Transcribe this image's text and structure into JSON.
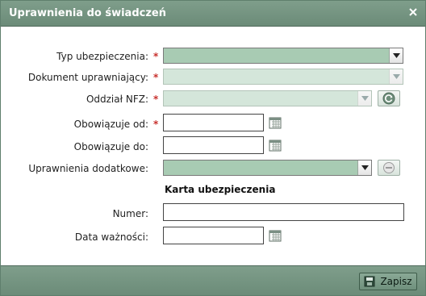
{
  "dialog": {
    "title": "Uprawnienia do świadczeń",
    "fields": {
      "typ_ubezpieczenia": {
        "label": "Typ ubezpieczenia:",
        "required_mark": "*"
      },
      "dokument_uprawniajacy": {
        "label": "Dokument uprawniający:",
        "required_mark": "*"
      },
      "oddzial_nfz": {
        "label": "Oddział NFZ:",
        "required_mark": "*"
      },
      "obowiazuje_od": {
        "label": "Obowiązuje od:",
        "required_mark": "*"
      },
      "obowiazuje_do": {
        "label": "Obowiązuje do:"
      },
      "uprawnienia_dodatkowe": {
        "label": "Uprawnienia dodatkowe:"
      }
    },
    "section_karta": {
      "title": "Karta ubezpieczenia"
    },
    "karta_fields": {
      "numer": {
        "label": "Numer:"
      },
      "data_waznosci": {
        "label": "Data ważności:"
      }
    },
    "footer": {
      "save_label": "Zapisz"
    }
  },
  "colors": {
    "titlebar": "#7393800",
    "accent": "#6b8b78",
    "select_fill": "#a8cbb3",
    "required": "#c8302d"
  },
  "icons": [
    "close-icon",
    "calendar-icon",
    "refresh-icon",
    "remove-icon",
    "save-icon",
    "chevron-down-icon"
  ]
}
